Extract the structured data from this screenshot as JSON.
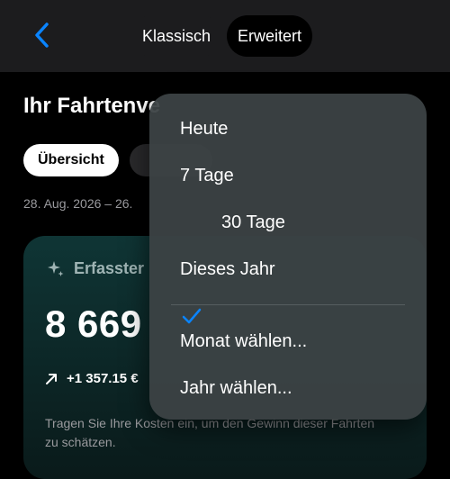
{
  "nav": {
    "modes": [
      "Klassisch",
      "Erweitert"
    ],
    "selected_mode": "Erweitert"
  },
  "header": {
    "title": "Ihr Fahrtenve"
  },
  "tabs": {
    "active_label": "Übersicht"
  },
  "date_range": "28. Aug. 2026 – 26.",
  "card": {
    "label": "Erfasster",
    "value": "8 669",
    "delta": "+1 357.15 €",
    "note": "Tragen Sie Ihre Kosten ein, um den Gewinn dieser Fahrten zu schätzen."
  },
  "menu": {
    "items": [
      "Heute",
      "7 Tage",
      "30 Tage",
      "Dieses Jahr"
    ],
    "selected": "30 Tage",
    "actions": [
      "Monat wählen...",
      "Jahr wählen..."
    ]
  },
  "colors": {
    "accent": "#0a84ff",
    "card_bg": "#0f3535",
    "menu_bg": "#3c4244"
  }
}
